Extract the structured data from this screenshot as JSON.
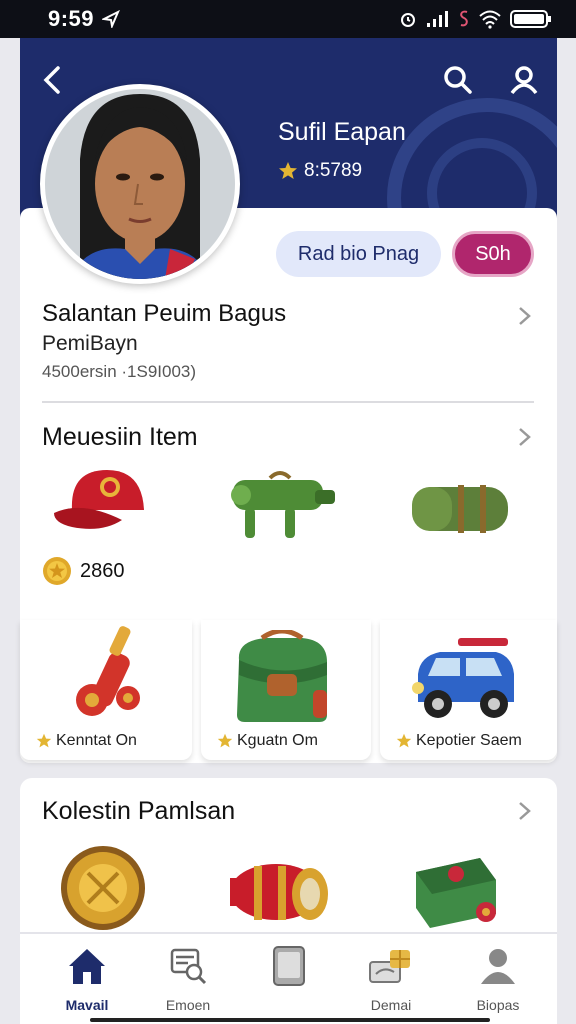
{
  "status": {
    "time": "9:59"
  },
  "profile": {
    "name": "Sufil Eapan",
    "score": "8:5789"
  },
  "actions": {
    "primary": "Rad bio Pnag",
    "secondary": "S0h"
  },
  "info": {
    "title": "Salantan Peuim Bagus",
    "subtitle": "PemiBayn",
    "meta": "4500ersin ·1S9I003)"
  },
  "items_section": {
    "title": "Meuesiin Item",
    "coins": "2860",
    "tiles": [
      {
        "label": "Kenntat On"
      },
      {
        "label": "Kguatn Om"
      },
      {
        "label": "Kepotier Saem"
      }
    ]
  },
  "collection": {
    "title": "Kolestin Pamlsan"
  },
  "nav": [
    {
      "label": "Mavail",
      "icon": "home-icon"
    },
    {
      "label": "Emoen",
      "icon": "search-list-icon"
    },
    {
      "label": "",
      "icon": "tablet-icon"
    },
    {
      "label": "Demai",
      "icon": "gift-icon"
    },
    {
      "label": "Biopas",
      "icon": "profile-icon"
    }
  ],
  "colors": {
    "header": "#1e2c6b",
    "accent": "#b0266d",
    "pill": "#e2e8fa"
  }
}
